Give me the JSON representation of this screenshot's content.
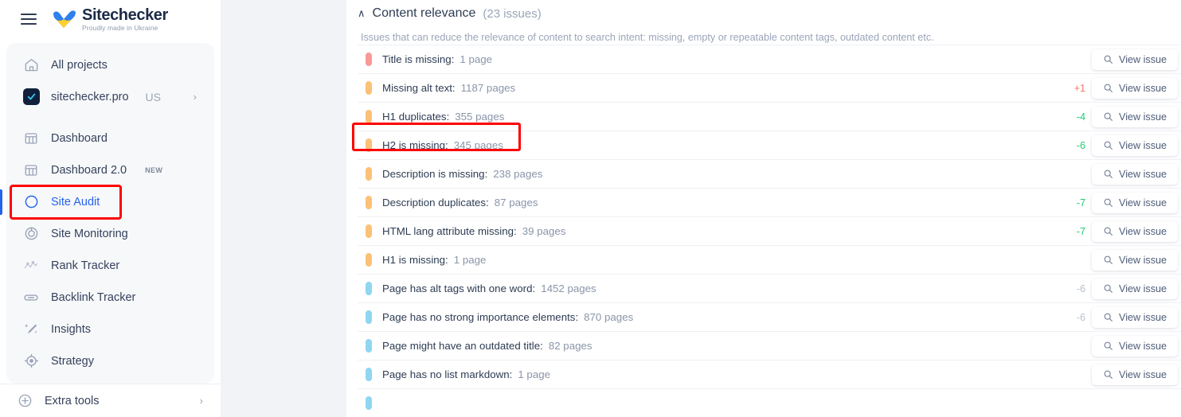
{
  "brand": {
    "title": "Sitechecker",
    "tagline": "Proudly made in Ukraine",
    "menu_icon": "hamburger-icon"
  },
  "sidebar": {
    "top_items": [
      {
        "label": "All projects",
        "icon": "home-icon"
      }
    ],
    "project": {
      "label": "sitechecker.pro",
      "country": "US",
      "chevron": "›",
      "icon": "project-check-icon"
    },
    "items": [
      {
        "label": "Dashboard",
        "icon": "dashboard-icon",
        "active": false,
        "badge": ""
      },
      {
        "label": "Dashboard 2.0",
        "icon": "dashboard-icon",
        "active": false,
        "badge": "NEW"
      },
      {
        "label": "Site Audit",
        "icon": "site-audit-icon",
        "active": true,
        "badge": ""
      },
      {
        "label": "Site Monitoring",
        "icon": "site-monitoring-icon",
        "active": false,
        "badge": ""
      },
      {
        "label": "Rank Tracker",
        "icon": "rank-tracker-icon",
        "active": false,
        "badge": ""
      },
      {
        "label": "Backlink Tracker",
        "icon": "link-icon",
        "active": false,
        "badge": ""
      },
      {
        "label": "Insights",
        "icon": "magic-wand-icon",
        "active": false,
        "badge": ""
      },
      {
        "label": "Strategy",
        "icon": "target-icon",
        "active": false,
        "badge": ""
      }
    ],
    "extra": {
      "label": "Extra tools",
      "icon": "plus-circle-icon",
      "chevron": "›"
    }
  },
  "section": {
    "title": "Content relevance",
    "count": "(23 issues)",
    "caret": "∧",
    "description": "Issues that can reduce the relevance of content to search intent: missing, empty or repeatable content tags, outdated content etc."
  },
  "colors": {
    "severity_critical": "#f89a95",
    "severity_warning": "#fbc177",
    "severity_notice": "#8fd6f2",
    "delta_up": "#f2736b",
    "delta_down": "#1fcc6f",
    "delta_muted": "#b7bfcc",
    "accent": "#2563eb",
    "highlight": "#ff0000"
  },
  "view_issue_label": "View issue",
  "view_issue_icon": "search-icon",
  "issues": [
    {
      "label": "Title is missing:",
      "count": "1 page",
      "severity": "critical",
      "delta": "",
      "delta_dir": "none",
      "highlighted": false
    },
    {
      "label": "Missing alt text:",
      "count": "1187 pages",
      "severity": "warning",
      "delta": "+1",
      "delta_dir": "up",
      "highlighted": false
    },
    {
      "label": "H1 duplicates:",
      "count": "355 pages",
      "severity": "warning",
      "delta": "-4",
      "delta_dir": "down",
      "highlighted": true
    },
    {
      "label": "H2 is missing:",
      "count": "345 pages",
      "severity": "warning",
      "delta": "-6",
      "delta_dir": "down",
      "highlighted": false
    },
    {
      "label": "Description is missing:",
      "count": "238 pages",
      "severity": "warning",
      "delta": "",
      "delta_dir": "none",
      "highlighted": false
    },
    {
      "label": "Description duplicates:",
      "count": "87 pages",
      "severity": "warning",
      "delta": "-7",
      "delta_dir": "down",
      "highlighted": false
    },
    {
      "label": "HTML lang attribute missing:",
      "count": "39 pages",
      "severity": "warning",
      "delta": "-7",
      "delta_dir": "down",
      "highlighted": false
    },
    {
      "label": "H1 is missing:",
      "count": "1 page",
      "severity": "warning",
      "delta": "",
      "delta_dir": "none",
      "highlighted": false
    },
    {
      "label": "Page has alt tags with one word:",
      "count": "1452 pages",
      "severity": "notice",
      "delta": "-6",
      "delta_dir": "muted",
      "highlighted": false
    },
    {
      "label": "Page has no strong importance elements:",
      "count": "870 pages",
      "severity": "notice",
      "delta": "-6",
      "delta_dir": "muted",
      "highlighted": false
    },
    {
      "label": "Page might have an outdated title:",
      "count": "82 pages",
      "severity": "notice",
      "delta": "",
      "delta_dir": "none",
      "highlighted": false
    },
    {
      "label": "Page has no list markdown:",
      "count": "1 page",
      "severity": "notice",
      "delta": "",
      "delta_dir": "none",
      "highlighted": false
    },
    {
      "label": "",
      "count": "",
      "severity": "notice",
      "delta": "",
      "delta_dir": "none",
      "highlighted": false
    }
  ]
}
